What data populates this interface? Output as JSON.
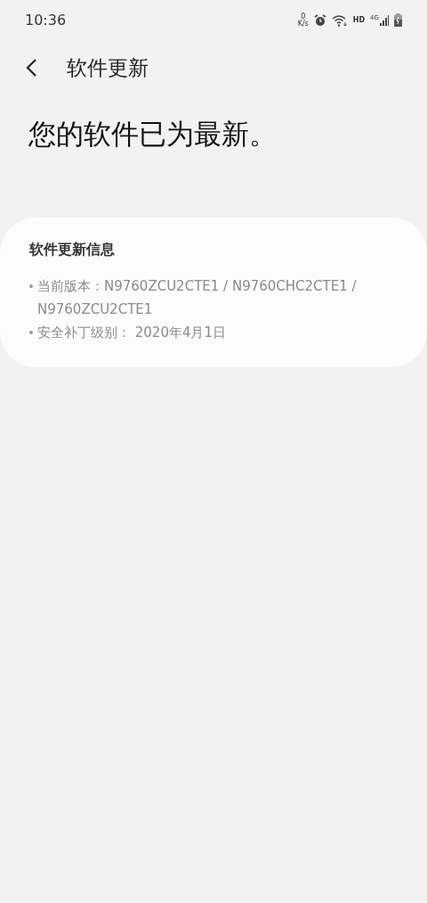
{
  "status_bar": {
    "time": "10:36",
    "net_speed": "0",
    "net_unit": "K/s",
    "hd": "HD",
    "network": "4G"
  },
  "header": {
    "title": "软件更新"
  },
  "heading": "您的软件已为最新。",
  "info_card": {
    "title": "软件更新信息",
    "items": [
      "当前版本：N9760ZCU2CTE1 / N9760CHC2CTE1 / N9760ZCU2CTE1",
      "安全补丁级别： 2020年4月1日"
    ]
  }
}
